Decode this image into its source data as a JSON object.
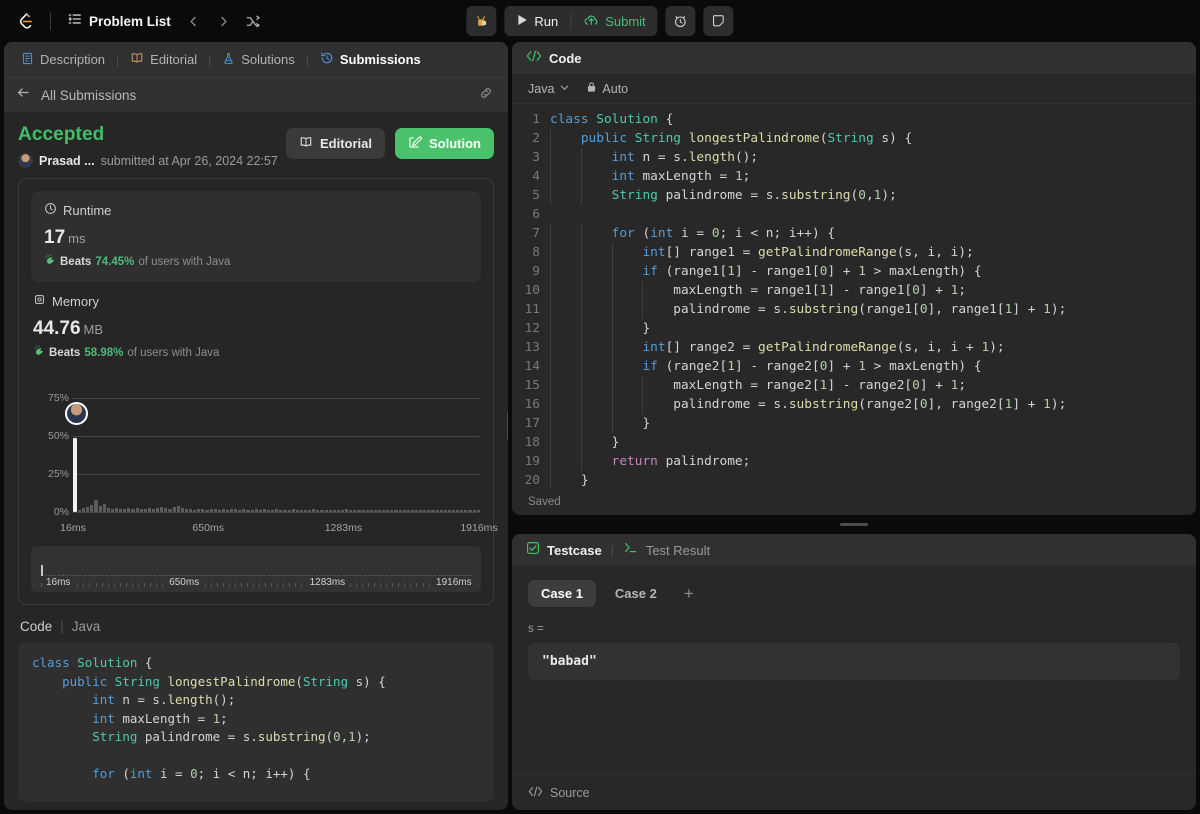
{
  "topbar": {
    "logo_icon": "leetcode-logo-icon",
    "problem_list_label": "Problem List",
    "list_icon": "list-icon",
    "prev_icon": "chevron-left-icon",
    "next_icon": "chevron-right-icon",
    "shuffle_icon": "shuffle-icon",
    "debug_icon": "debug-bug-icon",
    "run_label": "Run",
    "run_icon": "play-icon",
    "submit_label": "Submit",
    "submit_icon": "cloud-upload-icon",
    "timer_icon": "alarm-clock-icon",
    "note_icon": "note-icon",
    "submit_color": "#48bb78"
  },
  "left_panel": {
    "tabs": [
      {
        "label": "Description",
        "icon": "description-doc-icon",
        "active": false
      },
      {
        "label": "Editorial",
        "icon": "editorial-book-icon",
        "active": false
      },
      {
        "label": "Solutions",
        "icon": "solutions-flask-icon",
        "active": false
      },
      {
        "label": "Submissions",
        "icon": "submissions-history-icon",
        "active": true
      }
    ],
    "back_label": "All Submissions",
    "back_icon": "arrow-left-icon",
    "link_icon": "link-chain-icon",
    "status": "Accepted",
    "status_color": "#3fbf67",
    "username": "Prasad ...",
    "submitted_text": "submitted at Apr 26, 2024 22:57",
    "editorial_button": "Editorial",
    "solution_button": "Solution",
    "runtime": {
      "title": "Runtime",
      "icon": "clock-icon",
      "value": "17",
      "unit": "ms",
      "beats_label": "Beats",
      "beats_pct": "74.45%",
      "beats_suffix": "of users with Java",
      "beats_icon": "hand-clap-icon"
    },
    "memory": {
      "title": "Memory",
      "icon": "memory-chip-icon",
      "value": "44.76",
      "unit": "MB",
      "beats_label": "Beats",
      "beats_pct": "58.98%",
      "beats_suffix": "of users with Java",
      "beats_icon": "hand-clap-icon"
    },
    "code_section": {
      "title": "Code",
      "separator": "|",
      "language": "Java"
    },
    "solution_code": "class Solution {\n    public String longestPalindrome(String s) {\n        int n = s.length();\n        int maxLength = 1;\n        String palindrome = s.substring(0,1);\n\n        for (int i = 0; i < n; i++) {"
  },
  "chart_data": {
    "type": "bar",
    "title": "Memory distribution",
    "xlabel": "",
    "ylabel": "",
    "ylim": [
      0,
      87
    ],
    "yticks": [
      0,
      25,
      50,
      75
    ],
    "ytick_labels": [
      "0%",
      "25%",
      "50%",
      "75%"
    ],
    "xtick_labels": [
      "16ms",
      "650ms",
      "1283ms",
      "1916ms"
    ],
    "xtick_positions": [
      0,
      33.3,
      66.6,
      100
    ],
    "grid": true,
    "legend": "none",
    "highlight_index": 0,
    "highlight_value": 49,
    "highlight_marker": "user-avatar",
    "marker_pct": 58.98,
    "values": [
      49,
      1.5,
      2.5,
      3,
      4.5,
      8,
      4,
      5,
      2.5,
      2,
      2.5,
      2,
      2,
      2.5,
      2,
      2.5,
      2,
      2,
      2.5,
      2,
      2.5,
      3,
      2.5,
      2,
      3.5,
      4,
      2.5,
      2,
      2,
      1.5,
      2,
      2,
      1.5,
      2,
      2,
      1.5,
      2,
      1.5,
      2,
      2,
      1.5,
      2,
      1.5,
      1.5,
      2,
      1.5,
      2,
      1.5,
      1.5,
      2,
      1.5,
      1.5,
      1.5,
      2,
      1.5,
      1.5,
      1.5,
      1.5,
      2,
      1.5,
      1.5,
      1.5,
      1.5,
      1.5,
      1.5,
      1.5,
      2,
      1.5,
      1.5,
      1.5,
      1.5,
      1.5,
      1.5,
      1.5,
      1.5,
      1.5,
      1.5,
      1.5,
      1.5,
      1,
      1.5,
      1,
      1.5,
      1,
      1.5,
      1,
      1.5,
      1,
      1.5,
      1,
      1,
      1.5,
      1,
      1,
      1.5,
      1,
      1,
      1,
      1
    ]
  },
  "code_panel": {
    "title": "Code",
    "icon": "code-brackets-icon",
    "language": "Java",
    "language_chevron": "chevron-down-icon",
    "auto_label": "Auto",
    "auto_icon": "lock-icon",
    "saved_label": "Saved",
    "lines": [
      {
        "n": "1",
        "text": "class Solution {"
      },
      {
        "n": "2",
        "text": "    public String longestPalindrome(String s) {"
      },
      {
        "n": "3",
        "text": "        int n = s.length();"
      },
      {
        "n": "4",
        "text": "        int maxLength = 1;"
      },
      {
        "n": "5",
        "text": "        String palindrome = s.substring(0,1);"
      },
      {
        "n": "6",
        "text": ""
      },
      {
        "n": "7",
        "text": "        for (int i = 0; i < n; i++) {"
      },
      {
        "n": "8",
        "text": "            int[] range1 = getPalindromeRange(s, i, i);"
      },
      {
        "n": "9",
        "text": "            if (range1[1] - range1[0] + 1 > maxLength) {"
      },
      {
        "n": "10",
        "text": "                maxLength = range1[1] - range1[0] + 1;"
      },
      {
        "n": "11",
        "text": "                palindrome = s.substring(range1[0], range1[1] + 1);"
      },
      {
        "n": "12",
        "text": "            }"
      },
      {
        "n": "13",
        "text": "            int[] range2 = getPalindromeRange(s, i, i + 1);"
      },
      {
        "n": "14",
        "text": "            if (range2[1] - range2[0] + 1 > maxLength) {"
      },
      {
        "n": "15",
        "text": "                maxLength = range2[1] - range2[0] + 1;"
      },
      {
        "n": "16",
        "text": "                palindrome = s.substring(range2[0], range2[1] + 1);"
      },
      {
        "n": "17",
        "text": "            }"
      },
      {
        "n": "18",
        "text": "        }"
      },
      {
        "n": "19",
        "text": "        return palindrome;"
      },
      {
        "n": "20",
        "text": "    }"
      }
    ]
  },
  "testcase_panel": {
    "tab_testcase": "Testcase",
    "tab_testcase_icon": "checkbox-checked-icon",
    "tab_result": "Test Result",
    "tab_result_icon": "terminal-icon",
    "separator": "|",
    "cases": [
      {
        "label": "Case 1",
        "active": true
      },
      {
        "label": "Case 2",
        "active": false
      }
    ],
    "add_case_icon": "plus-icon",
    "input_label": "s =",
    "input_value": "\"babad\"",
    "source_label": "Source",
    "source_icon": "code-brackets-icon"
  }
}
